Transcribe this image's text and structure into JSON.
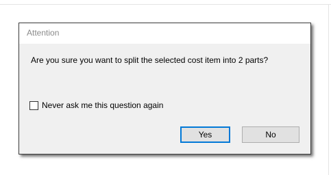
{
  "dialog": {
    "title": "Attention",
    "message": "Are you sure you want to split the selected cost item into 2 parts?",
    "checkbox": {
      "label": "Never ask me this question again",
      "checked": false
    },
    "buttons": {
      "yes_label": "Yes",
      "no_label": "No"
    }
  },
  "colors": {
    "dialog_background": "#f0f0f0",
    "title_text": "#8a8a8a",
    "default_button_border": "#0078d7"
  }
}
